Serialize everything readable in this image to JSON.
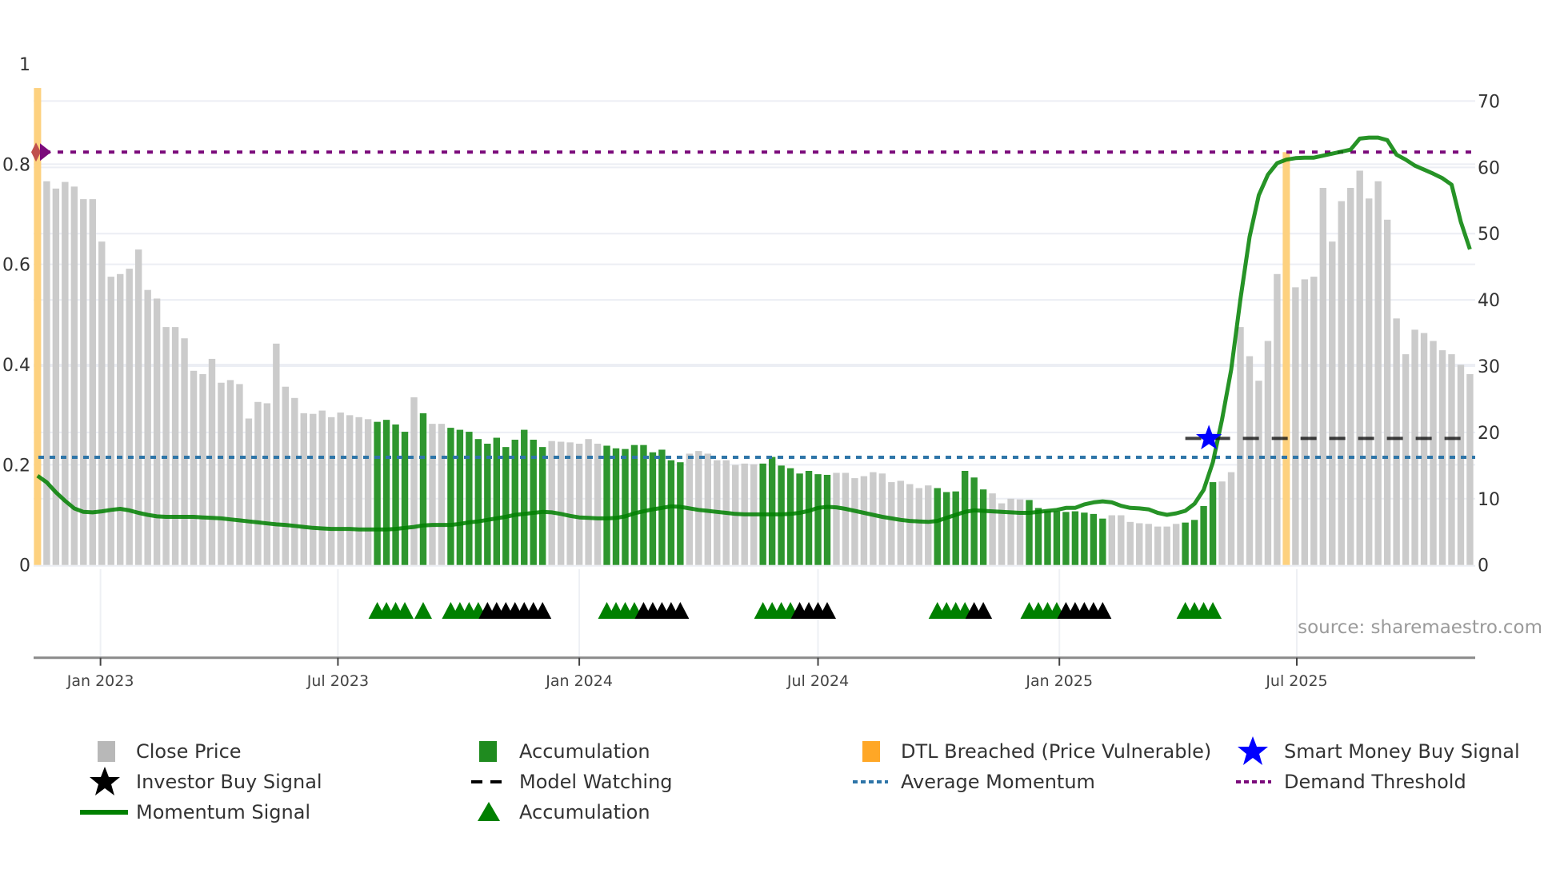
{
  "chart_data": {
    "type": "bar",
    "title": "",
    "xlim": [
      "2022-11-11",
      "2025-11-14"
    ],
    "x_ticks": [
      "2023-01-01",
      "2023-07-01",
      "2024-01-01",
      "2024-07-01",
      "2025-01-01",
      "2025-07-01"
    ],
    "x_tick_labels": [
      "Jan 2023",
      "Jul 2023",
      "Jan 2024",
      "Jul 2024",
      "Jan 2025",
      "Jul 2025"
    ],
    "y_left": {
      "ylim": [
        0,
        1
      ],
      "ticks": [
        0,
        0.2,
        0.4,
        0.6,
        0.8,
        1
      ],
      "tick_labels": [
        "0",
        "0.2",
        "0.4",
        "0.6",
        "0.8",
        "1"
      ]
    },
    "y_right": {
      "ylim": [
        0,
        75.6
      ],
      "ticks": [
        0,
        10,
        20,
        30,
        40,
        50,
        60,
        70
      ],
      "tick_labels": [
        "0",
        "10",
        "20",
        "30",
        "40",
        "50",
        "60",
        "70"
      ]
    },
    "grid": true,
    "legend_position": "bottom",
    "dates": [
      "2022-11-14",
      "2022-11-21",
      "2022-11-28",
      "2022-12-05",
      "2022-12-12",
      "2022-12-19",
      "2022-12-26",
      "2023-01-02",
      "2023-01-09",
      "2023-01-16",
      "2023-01-23",
      "2023-01-30",
      "2023-02-06",
      "2023-02-13",
      "2023-02-20",
      "2023-02-27",
      "2023-03-06",
      "2023-03-13",
      "2023-03-20",
      "2023-03-27",
      "2023-04-03",
      "2023-04-10",
      "2023-04-17",
      "2023-04-24",
      "2023-05-01",
      "2023-05-08",
      "2023-05-15",
      "2023-05-22",
      "2023-05-29",
      "2023-06-05",
      "2023-06-12",
      "2023-06-19",
      "2023-06-26",
      "2023-07-03",
      "2023-07-10",
      "2023-07-17",
      "2023-07-24",
      "2023-07-31",
      "2023-08-07",
      "2023-08-14",
      "2023-08-21",
      "2023-08-28",
      "2023-09-04",
      "2023-09-11",
      "2023-09-18",
      "2023-09-25",
      "2023-10-02",
      "2023-10-09",
      "2023-10-16",
      "2023-10-23",
      "2023-10-30",
      "2023-11-06",
      "2023-11-13",
      "2023-11-20",
      "2023-11-27",
      "2023-12-04",
      "2023-12-11",
      "2023-12-18",
      "2023-12-25",
      "2024-01-01",
      "2024-01-08",
      "2024-01-15",
      "2024-01-22",
      "2024-01-29",
      "2024-02-05",
      "2024-02-12",
      "2024-02-19",
      "2024-02-26",
      "2024-03-04",
      "2024-03-11",
      "2024-03-18",
      "2024-03-25",
      "2024-04-01",
      "2024-04-08",
      "2024-04-15",
      "2024-04-22",
      "2024-04-29",
      "2024-05-06",
      "2024-05-13",
      "2024-05-20",
      "2024-05-27",
      "2024-06-03",
      "2024-06-10",
      "2024-06-17",
      "2024-06-24",
      "2024-07-01",
      "2024-07-08",
      "2024-07-15",
      "2024-07-22",
      "2024-07-29",
      "2024-08-05",
      "2024-08-12",
      "2024-08-19",
      "2024-08-26",
      "2024-09-02",
      "2024-09-09",
      "2024-09-16",
      "2024-09-23",
      "2024-09-30",
      "2024-10-07",
      "2024-10-14",
      "2024-10-21",
      "2024-10-28",
      "2024-11-04",
      "2024-11-11",
      "2024-11-18",
      "2024-11-25",
      "2024-12-02",
      "2024-12-09",
      "2024-12-16",
      "2024-12-23",
      "2024-12-30",
      "2025-01-06",
      "2025-01-13",
      "2025-01-20",
      "2025-01-27",
      "2025-02-03",
      "2025-02-10",
      "2025-02-17",
      "2025-02-24",
      "2025-03-03",
      "2025-03-10",
      "2025-03-17",
      "2025-03-24",
      "2025-03-31",
      "2025-04-07",
      "2025-04-14",
      "2025-04-21",
      "2025-04-28",
      "2025-05-05",
      "2025-05-12",
      "2025-05-19",
      "2025-05-26",
      "2025-06-02",
      "2025-06-09",
      "2025-06-16",
      "2025-06-23",
      "2025-06-30",
      "2025-07-07",
      "2025-07-14",
      "2025-07-21",
      "2025-07-28",
      "2025-08-04",
      "2025-08-11",
      "2025-08-18",
      "2025-08-25",
      "2025-09-01",
      "2025-09-08",
      "2025-09-15",
      "2025-09-22",
      "2025-09-29",
      "2025-10-06",
      "2025-10-13",
      "2025-10-20",
      "2025-10-27",
      "2025-11-03",
      "2025-11-10"
    ],
    "close_price": [
      null,
      57.9,
      56.8,
      57.8,
      57.1,
      55.2,
      55.2,
      48.8,
      43.5,
      43.9,
      44.7,
      47.6,
      41.5,
      40.2,
      35.9,
      35.9,
      34.2,
      29.3,
      28.8,
      31.1,
      27.5,
      27.9,
      27.3,
      22.1,
      24.6,
      24.4,
      33.4,
      26.9,
      25.2,
      22.9,
      22.8,
      23.3,
      22.3,
      23.0,
      22.6,
      22.3,
      22.0,
      21.6,
      21.9,
      21.2,
      20.1,
      25.3,
      22.9,
      21.3,
      21.3,
      20.7,
      20.4,
      20.1,
      19.0,
      18.3,
      19.2,
      17.8,
      18.9,
      20.4,
      18.9,
      17.8,
      18.7,
      18.6,
      18.5,
      18.3,
      19.0,
      18.3,
      18.0,
      17.6,
      17.5,
      18.1,
      18.1,
      17.0,
      17.4,
      15.8,
      15.5,
      16.8,
      17.2,
      16.8,
      15.8,
      15.8,
      15.1,
      15.3,
      15.2,
      15.3,
      16.3,
      15.0,
      14.6,
      13.8,
      14.2,
      13.7,
      13.6,
      13.9,
      13.9,
      13.1,
      13.4,
      14.0,
      13.8,
      12.5,
      12.7,
      12.2,
      11.6,
      12.0,
      11.6,
      11.0,
      11.1,
      14.2,
      13.2,
      11.4,
      10.8,
      9.3,
      10.0,
      9.9,
      9.8,
      8.6,
      8.2,
      8.1,
      8.0,
      8.1,
      7.9,
      7.7,
      7.0,
      7.5,
      7.5,
      6.5,
      6.3,
      6.2,
      5.8,
      5.8,
      6.2,
      6.4,
      6.8,
      8.9,
      12.5,
      12.6,
      14.0,
      35.9,
      31.5,
      27.8,
      33.8,
      43.9,
      null,
      41.9,
      43.1,
      43.5,
      56.9,
      48.8,
      54.9,
      56.9,
      59.5,
      55.3,
      57.9,
      52.1,
      37.2,
      31.8,
      35.5,
      35.0,
      33.8,
      32.4,
      31.8,
      30.2,
      28.8
    ],
    "momentum_signal": [
      0.178,
      0.165,
      0.145,
      0.128,
      0.113,
      0.106,
      0.105,
      0.107,
      0.11,
      0.112,
      0.109,
      0.104,
      0.1,
      0.097,
      0.096,
      0.096,
      0.096,
      0.096,
      0.095,
      0.094,
      0.093,
      0.091,
      0.089,
      0.087,
      0.085,
      0.083,
      0.081,
      0.08,
      0.078,
      0.076,
      0.074,
      0.073,
      0.072,
      0.072,
      0.072,
      0.071,
      0.071,
      0.071,
      0.071,
      0.072,
      0.074,
      0.076,
      0.079,
      0.08,
      0.08,
      0.08,
      0.082,
      0.085,
      0.087,
      0.09,
      0.093,
      0.096,
      0.1,
      0.102,
      0.104,
      0.106,
      0.105,
      0.102,
      0.098,
      0.095,
      0.094,
      0.093,
      0.093,
      0.094,
      0.097,
      0.103,
      0.107,
      0.111,
      0.114,
      0.117,
      0.116,
      0.113,
      0.11,
      0.108,
      0.106,
      0.104,
      0.102,
      0.101,
      0.101,
      0.101,
      0.101,
      0.101,
      0.102,
      0.104,
      0.108,
      0.114,
      0.116,
      0.115,
      0.112,
      0.108,
      0.104,
      0.1,
      0.096,
      0.093,
      0.09,
      0.088,
      0.087,
      0.086,
      0.088,
      0.094,
      0.1,
      0.106,
      0.109,
      0.108,
      0.107,
      0.106,
      0.105,
      0.104,
      0.104,
      0.106,
      0.108,
      0.11,
      0.114,
      0.114,
      0.121,
      0.125,
      0.127,
      0.125,
      0.118,
      0.114,
      0.113,
      0.111,
      0.104,
      0.1,
      0.103,
      0.108,
      0.122,
      0.15,
      0.205,
      0.29,
      0.39,
      0.53,
      0.655,
      0.738,
      0.779,
      0.802,
      0.809,
      0.812,
      0.813,
      0.813,
      0.817,
      0.821,
      0.825,
      0.829,
      0.851,
      0.853,
      0.853,
      0.848,
      0.819,
      0.809,
      0.797,
      0.789,
      0.781,
      0.772,
      0.759,
      0.685,
      0.63
    ],
    "accumulation_bars": [
      {
        "from": "2023-07-31",
        "to": "2023-08-21"
      },
      {
        "from": "2023-09-04",
        "to": "2023-09-04"
      },
      {
        "from": "2023-09-25",
        "to": "2023-12-04"
      },
      {
        "from": "2024-01-22",
        "to": "2024-03-18"
      },
      {
        "from": "2024-05-20",
        "to": "2024-07-08"
      },
      {
        "from": "2024-09-30",
        "to": "2024-11-04"
      },
      {
        "from": "2024-12-09",
        "to": "2025-02-03"
      },
      {
        "from": "2025-04-07",
        "to": "2025-04-28"
      }
    ],
    "accumulation_markers": [
      {
        "from": "2023-07-31",
        "to": "2023-08-21"
      },
      {
        "from": "2023-09-04",
        "to": "2023-09-04"
      },
      {
        "from": "2023-09-25",
        "to": "2023-10-16"
      },
      {
        "from": "2024-01-22",
        "to": "2024-02-12"
      },
      {
        "from": "2024-05-20",
        "to": "2024-06-10"
      },
      {
        "from": "2024-09-30",
        "to": "2024-10-21"
      },
      {
        "from": "2024-12-09",
        "to": "2024-12-30"
      },
      {
        "from": "2025-04-07",
        "to": "2025-04-28"
      }
    ],
    "black_markers": [
      {
        "from": "2023-10-23",
        "to": "2023-12-04"
      },
      {
        "from": "2024-02-19",
        "to": "2024-03-18"
      },
      {
        "from": "2024-06-17",
        "to": "2024-07-08"
      },
      {
        "from": "2024-10-28",
        "to": "2024-11-04"
      },
      {
        "from": "2025-01-06",
        "to": "2025-02-03"
      }
    ],
    "dtl_breached": [
      {
        "date": "2022-11-14",
        "value": 0.952
      },
      {
        "date": "2025-06-23",
        "value": 0.824
      }
    ],
    "average_momentum": 0.215,
    "demand_threshold": 0.824,
    "model_watching": {
      "from": "2025-04-07",
      "to": "2025-11-10",
      "value": 19.1
    },
    "smart_money_buy_signal": {
      "date": "2025-04-25",
      "value": 19.1
    },
    "colors": {
      "close_price": "#cbcbcb",
      "accumulation": "#2e962e",
      "dtl_breached": "#fdd17f",
      "momentum_signal": "#008000",
      "average_momentum": "#2e75a8",
      "demand_threshold": "#7b0a7b",
      "smart_money_buy_signal": "#0000ff",
      "investor_buy_signal": "#000000",
      "model_watching": "#111111",
      "accumulation_marker": "#008000",
      "grid": "#eceef4"
    },
    "source": "source: sharemaestro.com",
    "legend": [
      {
        "label": "Close Price",
        "symbol": "square",
        "color": "#b8b8b8"
      },
      {
        "label": "Accumulation",
        "symbol": "square",
        "color": "#1f8b1f"
      },
      {
        "label": "DTL Breached (Price Vulnerable)",
        "symbol": "square",
        "color": "#ffa726"
      },
      {
        "label": "Smart Money Buy Signal",
        "symbol": "star",
        "color": "#0000ff"
      },
      {
        "label": "Investor Buy Signal",
        "symbol": "star",
        "color": "#000000"
      },
      {
        "label": "Model Watching",
        "symbol": "dash",
        "color": "#000000"
      },
      {
        "label": "Average Momentum",
        "symbol": "dot",
        "color": "#2e75a8"
      },
      {
        "label": "Demand Threshold",
        "symbol": "dot",
        "color": "#7b0a7b"
      },
      {
        "label": "Momentum Signal",
        "symbol": "line",
        "color": "#008000"
      },
      {
        "label": "Accumulation",
        "symbol": "triangle-up",
        "color": "#008000"
      }
    ]
  }
}
